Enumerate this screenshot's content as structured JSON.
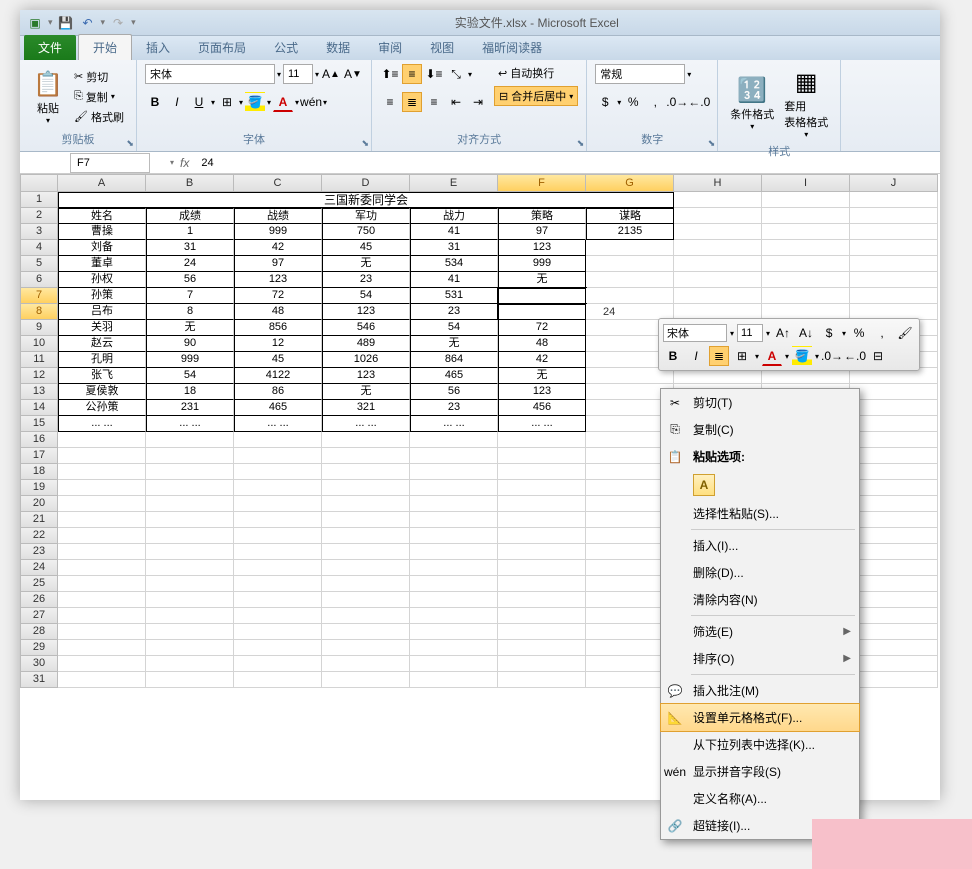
{
  "window": {
    "title": "实验文件.xlsx - Microsoft Excel"
  },
  "tabs": {
    "file": "文件",
    "home": "开始",
    "insert": "插入",
    "layout": "页面布局",
    "formulas": "公式",
    "data": "数据",
    "review": "审阅",
    "view": "视图",
    "foxit": "福昕阅读器"
  },
  "ribbon": {
    "clipboard": {
      "label": "剪贴板",
      "paste": "粘贴",
      "cut": "剪切",
      "copy": "复制",
      "painter": "格式刷"
    },
    "font": {
      "label": "字体",
      "name": "宋体",
      "size": "11"
    },
    "align": {
      "label": "对齐方式",
      "wrap": "自动换行",
      "merge": "合并后居中"
    },
    "number": {
      "label": "数字",
      "format": "常规"
    },
    "styles": {
      "label": "样式",
      "cond": "条件格式",
      "table": "套用\n表格格式"
    }
  },
  "formula_bar": {
    "cell_ref": "F7",
    "value": "24"
  },
  "columns": [
    "A",
    "B",
    "C",
    "D",
    "E",
    "F",
    "G",
    "H",
    "I",
    "J"
  ],
  "table": {
    "title": "三国新委同学会",
    "headers": [
      "姓名",
      "成绩",
      "战绩",
      "军功",
      "战力",
      "策略",
      "谋略"
    ],
    "rows": [
      [
        "曹操",
        "1",
        "999",
        "750",
        "41",
        "97",
        "2135"
      ],
      [
        "刘备",
        "31",
        "42",
        "45",
        "31",
        "123",
        ""
      ],
      [
        "董卓",
        "24",
        "97",
        "无",
        "534",
        "999",
        ""
      ],
      [
        "孙权",
        "56",
        "123",
        "23",
        "41",
        "无",
        ""
      ],
      [
        "孙策",
        "7",
        "72",
        "54",
        "531",
        "",
        ""
      ],
      [
        "吕布",
        "8",
        "48",
        "123",
        "23",
        "",
        ""
      ],
      [
        "关羽",
        "无",
        "856",
        "546",
        "54",
        "72",
        ""
      ],
      [
        "赵云",
        "90",
        "12",
        "489",
        "无",
        "48",
        ""
      ],
      [
        "孔明",
        "999",
        "45",
        "1026",
        "864",
        "42",
        ""
      ],
      [
        "张飞",
        "54",
        "4122",
        "123",
        "465",
        "无",
        ""
      ],
      [
        "夏侯敦",
        "18",
        "86",
        "无",
        "56",
        "123",
        ""
      ],
      [
        "公孙策",
        "231",
        "465",
        "321",
        "23",
        "456",
        ""
      ],
      [
        "... ...",
        "... ...",
        "... ...",
        "... ...",
        "... ...",
        "... ...",
        ""
      ]
    ]
  },
  "selection_value": "24",
  "mini": {
    "font": "宋体",
    "size": "11"
  },
  "context_menu": {
    "cut": "剪切(T)",
    "copy": "复制(C)",
    "paste_options": "粘贴选项:",
    "paste_special": "选择性粘贴(S)...",
    "insert": "插入(I)...",
    "delete": "删除(D)...",
    "clear": "清除内容(N)",
    "filter": "筛选(E)",
    "sort": "排序(O)",
    "insert_comment": "插入批注(M)",
    "format_cells": "设置单元格格式(F)...",
    "pick_list": "从下拉列表中选择(K)...",
    "phonetic": "显示拼音字段(S)",
    "define_name": "定义名称(A)...",
    "hyperlink": "超链接(I)..."
  }
}
